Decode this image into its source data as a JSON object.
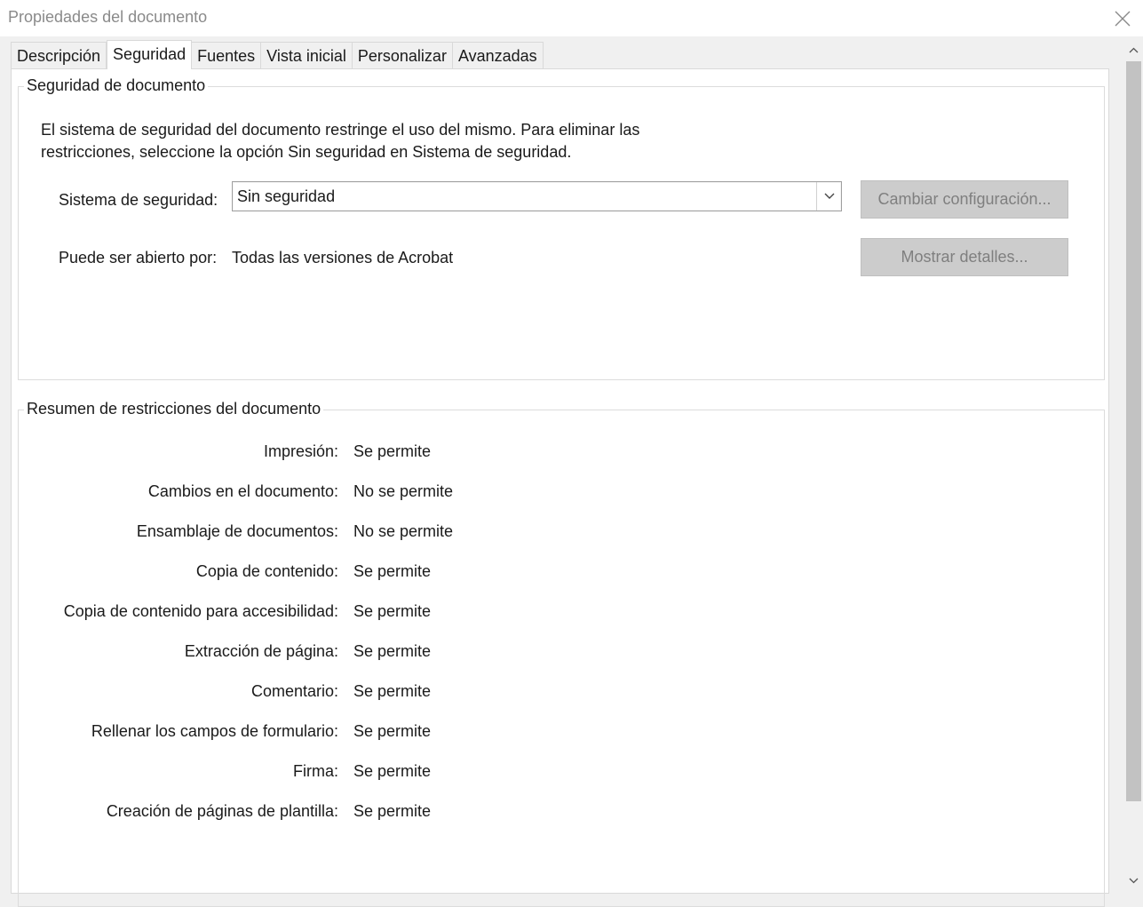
{
  "window": {
    "title": "Propiedades del documento",
    "close_icon": "close-icon"
  },
  "tabs": [
    {
      "label": "Descripción",
      "active": false
    },
    {
      "label": "Seguridad",
      "active": true
    },
    {
      "label": "Fuentes",
      "active": false
    },
    {
      "label": "Vista inicial",
      "active": false
    },
    {
      "label": "Personalizar",
      "active": false
    },
    {
      "label": "Avanzadas",
      "active": false
    }
  ],
  "security": {
    "legend": "Seguridad de documento",
    "description_line1": "El sistema de seguridad del documento restringe el uso del mismo. Para eliminar las",
    "description_line2": "restricciones, seleccione la opción Sin seguridad en Sistema de seguridad.",
    "system_label": "Sistema de seguridad:",
    "system_value": "Sin seguridad",
    "change_settings_button": "Cambiar configuración...",
    "opened_by_label": "Puede ser abierto por:",
    "opened_by_value": "Todas las versiones de Acrobat",
    "show_details_button": "Mostrar detalles..."
  },
  "summary": {
    "legend": "Resumen de restricciones del documento",
    "rows": [
      {
        "label": "Impresión:",
        "value": "Se permite"
      },
      {
        "label": "Cambios en el documento:",
        "value": "No se permite"
      },
      {
        "label": "Ensamblaje de documentos:",
        "value": "No se permite"
      },
      {
        "label": "Copia de contenido:",
        "value": "Se permite"
      },
      {
        "label": "Copia de contenido para accesibilidad:",
        "value": "Se permite"
      },
      {
        "label": "Extracción de página:",
        "value": "Se permite"
      },
      {
        "label": "Comentario:",
        "value": "Se permite"
      },
      {
        "label": "Rellenar los campos de formulario:",
        "value": "Se permite"
      },
      {
        "label": "Firma:",
        "value": "Se permite"
      },
      {
        "label": "Creación de páginas de plantilla:",
        "value": "Se permite"
      }
    ]
  },
  "colors": {
    "window_bg": "#f0f0f0",
    "panel_bg": "#ffffff",
    "disabled_button_bg": "#cccccc",
    "disabled_button_text": "#7f7f7f"
  }
}
